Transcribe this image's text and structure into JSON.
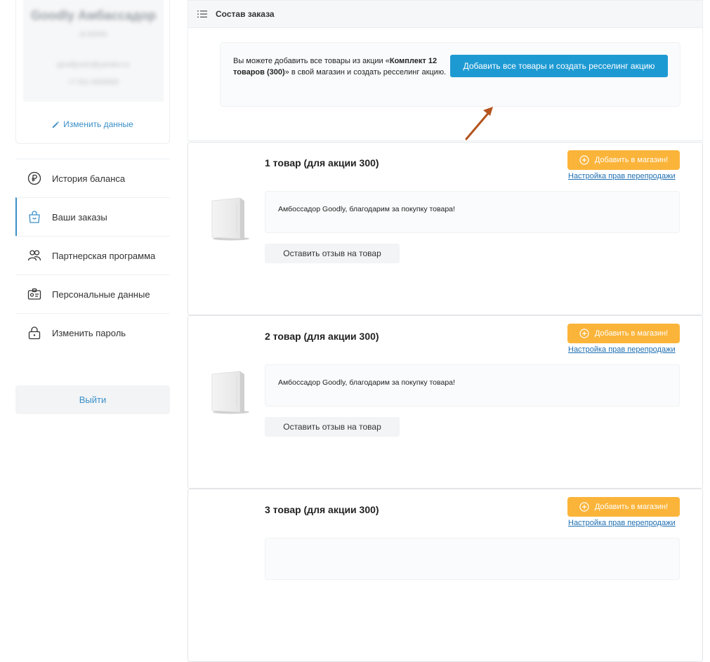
{
  "profile": {
    "name": "Goodly Амбассадор",
    "subtitle": "id 00000",
    "email": "goodlyuser@yandex.ru",
    "phone": "+7 911 0000000",
    "edit_label": "Изменить данные"
  },
  "menu": {
    "items": [
      {
        "label": "История баланса",
        "icon": "ruble-icon"
      },
      {
        "label": "Ваши заказы",
        "icon": "shopping-bag-icon"
      },
      {
        "label": "Партнерская программа",
        "icon": "users-icon"
      },
      {
        "label": "Персональные данные",
        "icon": "id-card-icon"
      },
      {
        "label": "Изменить пароль",
        "icon": "lock-icon"
      }
    ],
    "active_index": 1,
    "logout_label": "Выйти"
  },
  "order": {
    "title": "Состав заказа",
    "resell_text_before": "Вы можете добавить все товары из акции «",
    "resell_text_bold": "Комплект 12 товаров (300)",
    "resell_text_after": "» в свой магазин и создать ресселинг акцию.",
    "resell_button": "Добавить все товары и создать ресселинг акцию"
  },
  "products": [
    {
      "title": "1 товар (для акции 300)",
      "add_label": "Добавить в магазин!",
      "rights_label": "Настройка прав перепродажи",
      "message": "Амбоссадор Goodly, благодарим за покупку товара!",
      "review_label": "Оставить отзыв на товар"
    },
    {
      "title": "2 товар (для акции 300)",
      "add_label": "Добавить в магазин!",
      "rights_label": "Настройка прав перепродажи",
      "message": "Амбоссадор Goodly, благодарим за покупку товара!",
      "review_label": "Оставить отзыв на товар"
    },
    {
      "title": "3 товар (для акции 300)",
      "add_label": "Добавить в магазин!",
      "rights_label": "Настройка прав перепродажи",
      "message": "",
      "review_label": ""
    }
  ],
  "colors": {
    "accent_blue": "#1e9ad3",
    "link_blue": "#3a8fc7",
    "add_orange": "#fbb43a",
    "arrow": "#b5541f"
  }
}
